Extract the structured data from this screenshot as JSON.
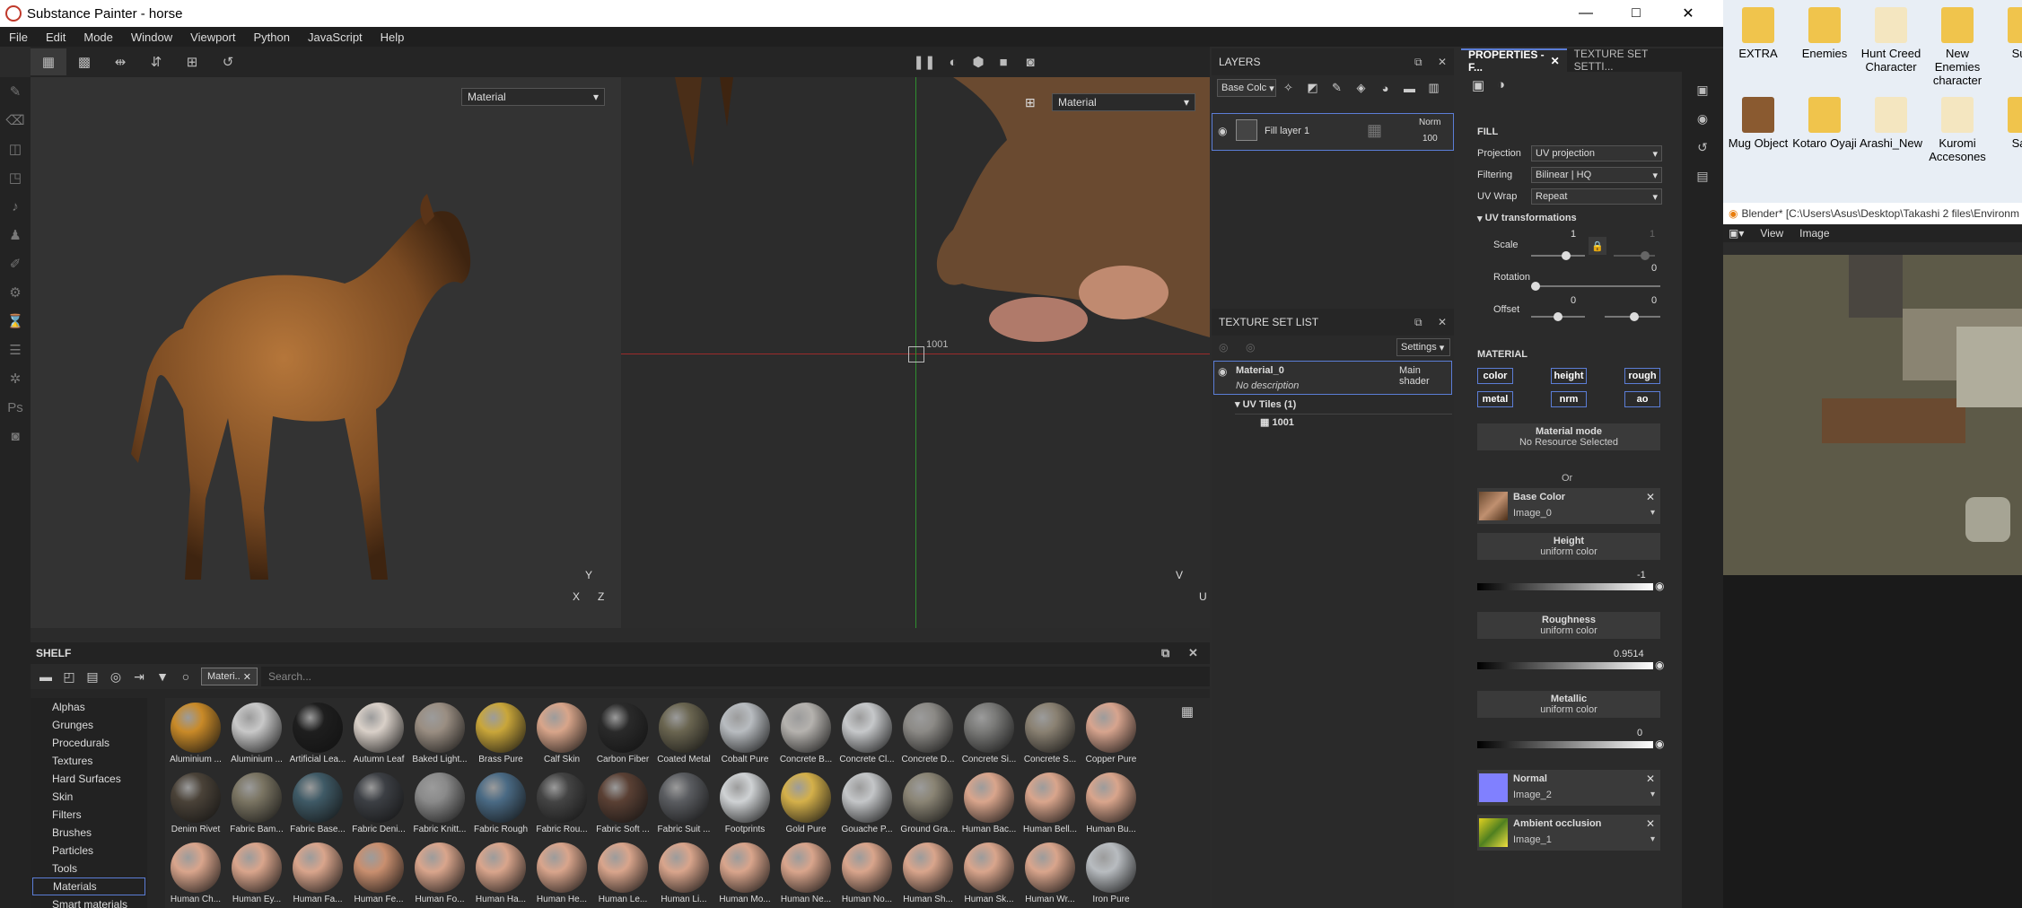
{
  "title": "Substance Painter - horse",
  "window_controls": {
    "minimize": "—",
    "maximize": "□",
    "close": "✕"
  },
  "menu": [
    "File",
    "Edit",
    "Mode",
    "Window",
    "Viewport",
    "Python",
    "JavaScript",
    "Help"
  ],
  "viewport": {
    "left_mode": "Material",
    "right_mode": "Material",
    "uv_tile_label": "1001",
    "axis_3d": {
      "y": "Y",
      "x": "X",
      "z": "Z"
    },
    "axis_2d": {
      "v": "V",
      "u": "U"
    }
  },
  "shelf": {
    "title": "SHELF",
    "filter_chip": "Materi..",
    "search_placeholder": "Search...",
    "categories": [
      "Alphas",
      "Grunges",
      "Procedurals",
      "Textures",
      "Hard Surfaces",
      "Skin",
      "Filters",
      "Brushes",
      "Particles",
      "Tools",
      "Materials",
      "Smart materials"
    ],
    "selected_category": "Materials",
    "materials": [
      [
        "Aluminium ...",
        "#c98a28"
      ],
      [
        "Aluminium ...",
        "#c8c8c8"
      ],
      [
        "Artificial Lea...",
        "#1e1e1e"
      ],
      [
        "Autumn Leaf",
        "#d9d0c8"
      ],
      [
        "Baked Light...",
        "#9a8e82"
      ],
      [
        "Brass Pure",
        "#c9a63a"
      ],
      [
        "Calf Skin",
        "#d8a58a"
      ],
      [
        "Carbon Fiber",
        "#2a2a2a"
      ],
      [
        "Coated Metal",
        "#6a6550"
      ],
      [
        "Cobalt Pure",
        "#b8bcc0"
      ],
      [
        "Concrete B...",
        "#b5b2ae"
      ],
      [
        "Concrete Cl...",
        "#c6c8ca"
      ],
      [
        "Concrete D...",
        "#8c8a86"
      ],
      [
        "Concrete Si...",
        "#7a7a78"
      ],
      [
        "Concrete S...",
        "#8a8172"
      ],
      [
        "Copper Pure",
        "#d7a48e"
      ],
      [
        "Denim Rivet",
        "#4a4238"
      ],
      [
        "Fabric Bam...",
        "#7a7462"
      ],
      [
        "Fabric Base...",
        "#3f5a66"
      ],
      [
        "Fabric Deni...",
        "#3c3f44"
      ],
      [
        "Fabric Knitt...",
        "#8a8a8a"
      ],
      [
        "Fabric Rough",
        "#4a6a84"
      ],
      [
        "Fabric Rou...",
        "#444"
      ],
      [
        "Fabric Soft ...",
        "#5a4034"
      ],
      [
        "Fabric Suit ...",
        "#5a5c60"
      ],
      [
        "Footprints",
        "#cfd2d4"
      ],
      [
        "Gold Pure",
        "#d4b04a"
      ],
      [
        "Gouache P...",
        "#c4c6c8"
      ],
      [
        "Ground Gra...",
        "#8a8474"
      ],
      [
        "Human Bac...",
        "#d9a58c"
      ],
      [
        "Human Bell...",
        "#d9a58c"
      ],
      [
        "Human Bu...",
        "#d9a58c"
      ],
      [
        "Human Ch...",
        "#d9a58c"
      ],
      [
        "Human Ey...",
        "#d9a58c"
      ],
      [
        "Human Fa...",
        "#d9a58c"
      ],
      [
        "Human Fe...",
        "#c98f6f"
      ],
      [
        "Human Fo...",
        "#d9a58c"
      ],
      [
        "Human Ha...",
        "#d9a58c"
      ],
      [
        "Human He...",
        "#d9a58c"
      ],
      [
        "Human Le...",
        "#d9a58c"
      ],
      [
        "Human Li...",
        "#d9a58c"
      ],
      [
        "Human Mo...",
        "#d9a58c"
      ],
      [
        "Human Ne...",
        "#d9a58c"
      ],
      [
        "Human No...",
        "#d9a58c"
      ],
      [
        "Human Sh...",
        "#d9a58c"
      ],
      [
        "Human Sk...",
        "#d9a58c"
      ],
      [
        "Human Wr...",
        "#d9a58c"
      ],
      [
        "Iron Pure",
        "#b8bcc0"
      ]
    ]
  },
  "layers": {
    "title": "LAYERS",
    "channel": "Base Colc",
    "items": [
      {
        "name": "Fill layer 1",
        "blend": "Norm",
        "opacity": "100"
      }
    ]
  },
  "texture_set_list": {
    "title": "TEXTURE SET LIST",
    "settings": "Settings",
    "material": "Material_0",
    "shader": "Main shader",
    "description": "No description",
    "uv_tiles": "UV Tiles (1)",
    "tile": "1001"
  },
  "properties": {
    "tab1": "PROPERTIES - F...",
    "tab2": "TEXTURE SET SETTI...",
    "fill": {
      "title": "FILL",
      "projection_label": "Projection",
      "projection": "UV projection",
      "filtering_label": "Filtering",
      "filtering": "Bilinear | HQ",
      "uvwrap_label": "UV Wrap",
      "uvwrap": "Repeat",
      "uvt_title": "UV transformations",
      "scale_label": "Scale",
      "scale_val": "1",
      "scale_val2": "1",
      "rotation_label": "Rotation",
      "rotation_val": "0",
      "offset_label": "Offset",
      "offset_val1": "0",
      "offset_val2": "0"
    },
    "material": {
      "title": "MATERIAL",
      "channels": [
        "color",
        "height",
        "rough",
        "metal",
        "nrm",
        "ao"
      ],
      "mode_title": "Material mode",
      "mode_sub": "No Resource Selected",
      "or": "Or",
      "base_color": {
        "title": "Base Color",
        "image": "Image_0"
      },
      "height": {
        "title": "Height",
        "sub": "uniform color",
        "value": "-1"
      },
      "roughness": {
        "title": "Roughness",
        "sub": "uniform color",
        "value": "0.9514"
      },
      "metallic": {
        "title": "Metallic",
        "sub": "uniform color",
        "value": "0"
      },
      "normal": {
        "title": "Normal",
        "image": "Image_2"
      },
      "ao": {
        "title": "Ambient occlusion",
        "image": "Image_1"
      }
    }
  },
  "desktop": {
    "icons": [
      "EXTRA",
      "Enemies",
      "Hunt Creed Character",
      "New Enemies character",
      "Su...",
      "Mug Object",
      "Kotaro Oyaji",
      "Arashi_New",
      "Kuromi Accesones",
      "Sa..."
    ]
  },
  "blender": {
    "title": "Blender* [C:\\Users\\Asus\\Desktop\\Takashi 2 files\\Environm",
    "menu": [
      "View",
      "Image"
    ]
  }
}
